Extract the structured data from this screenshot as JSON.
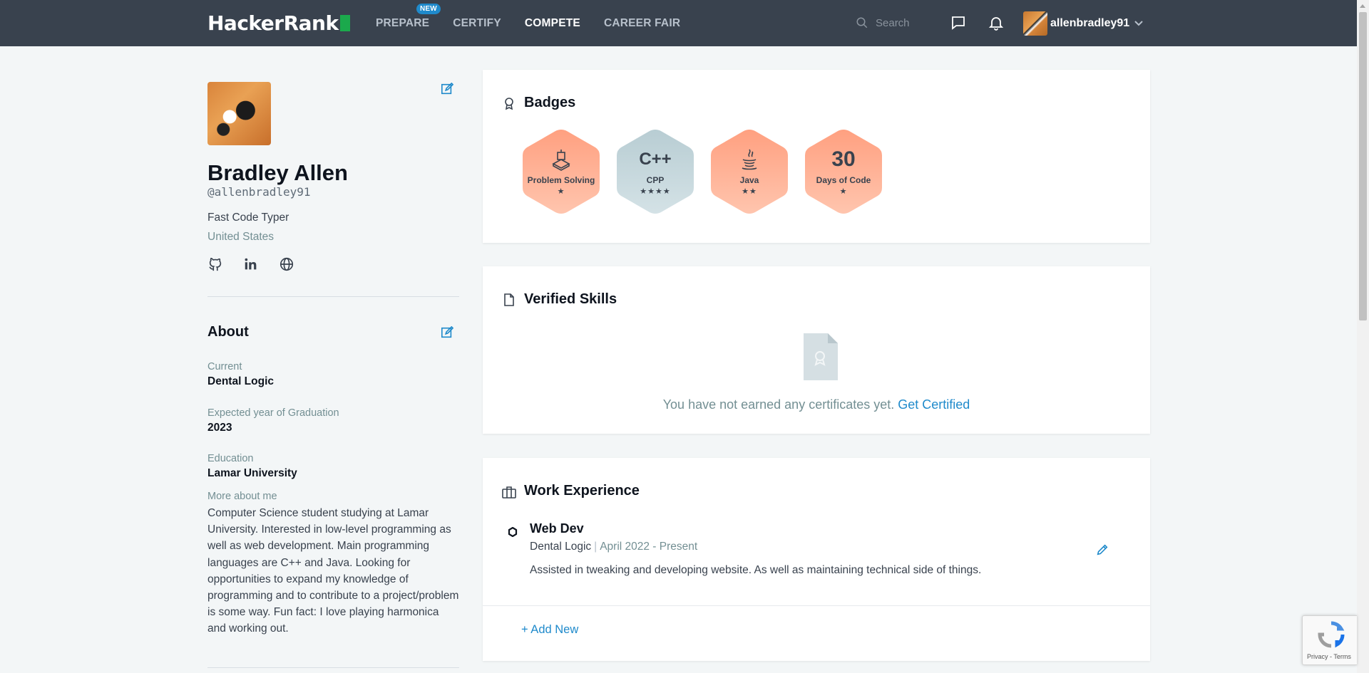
{
  "nav": {
    "logo_text": "HackerRank",
    "links": [
      {
        "label": "PREPARE",
        "badge": "NEW"
      },
      {
        "label": "CERTIFY"
      },
      {
        "label": "COMPETE",
        "active": true
      },
      {
        "label": "CAREER FAIR"
      }
    ],
    "search_placeholder": "Search",
    "username": "allenbradley91",
    "icons": [
      "search-icon",
      "messages-icon",
      "notifications-icon",
      "chevron-down-icon"
    ]
  },
  "profile": {
    "name": "Bradley Allen",
    "handle": "@allenbradley91",
    "tagline": "Fast Code Typer",
    "country": "United States",
    "social_icons": [
      "github-icon",
      "linkedin-icon",
      "website-icon"
    ]
  },
  "about": {
    "title": "About",
    "current_label": "Current",
    "current_value": "Dental Logic",
    "graduation_label": "Expected year of Graduation",
    "graduation_value": "2023",
    "education_label": "Education",
    "education_value": "Lamar University",
    "more_label": "More about me",
    "more_text": "Computer Science student studying at Lamar University. Interested in low-level programming as well as web development. Main programming languages are C++ and Java. Looking for opportunities to expand my knowledge of programming and to contribute to a project/problem is some way. Fun fact: I love playing harmonica and working out."
  },
  "badges": {
    "title": "Badges",
    "items": [
      {
        "name": "Problem Solving",
        "stars": "★",
        "icon": "problem-solving-icon",
        "color": "#ffab91"
      },
      {
        "name": "CPP",
        "stars": "★★★★",
        "icon_text": "C++",
        "color": "#bfd3d9"
      },
      {
        "name": "Java",
        "stars": "★★",
        "icon": "java-icon",
        "color": "#ffab91"
      },
      {
        "name": "Days of Code",
        "stars": "★",
        "number": "30",
        "color": "#ffab91"
      }
    ]
  },
  "verified_skills": {
    "title": "Verified Skills",
    "message": "You have not earned any certificates yet.",
    "link": "Get Certified"
  },
  "work_experience": {
    "title": "Work Experience",
    "job_title": "Web Dev",
    "company": "Dental Logic",
    "separator": "|",
    "dates": "April 2022 - Present",
    "description": "Assisted in tweaking and developing website. As well as maintaining technical side of things.",
    "add_new": "+ Add New"
  },
  "recaptcha": {
    "links": "Privacy - Terms"
  },
  "colors": {
    "nav_bg": "#39424e",
    "accent_green": "#1ba94c",
    "link_blue": "#1f8acb",
    "badge_gold": "#ffab91",
    "badge_silver": "#bfd3d9"
  }
}
